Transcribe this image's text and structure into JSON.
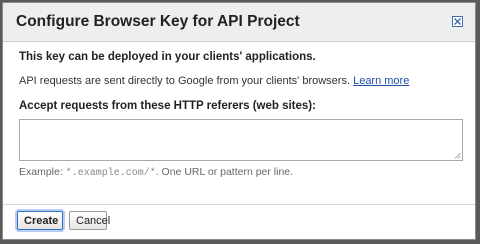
{
  "dialog": {
    "title": "Configure Browser Key for API Project",
    "close_icon": "close-icon"
  },
  "body": {
    "deploy_note": "This key can be deployed in your clients' applications.",
    "info_text": "API requests are sent directly to Google from your clients' browsers.",
    "learn_more_link": "Learn more",
    "field_label": "Accept requests from these HTTP referers (web sites):",
    "referers_value": "",
    "example_prefix": "Example:",
    "example_code": "*.example.com/*",
    "example_suffix": ". One URL or pattern per line."
  },
  "buttons": {
    "create_label": "Create",
    "cancel_label": "Cancel"
  },
  "colors": {
    "link": "#1f4ea3",
    "header_bg": "#eeeeee",
    "focus_ring": "#b5cdf0"
  }
}
